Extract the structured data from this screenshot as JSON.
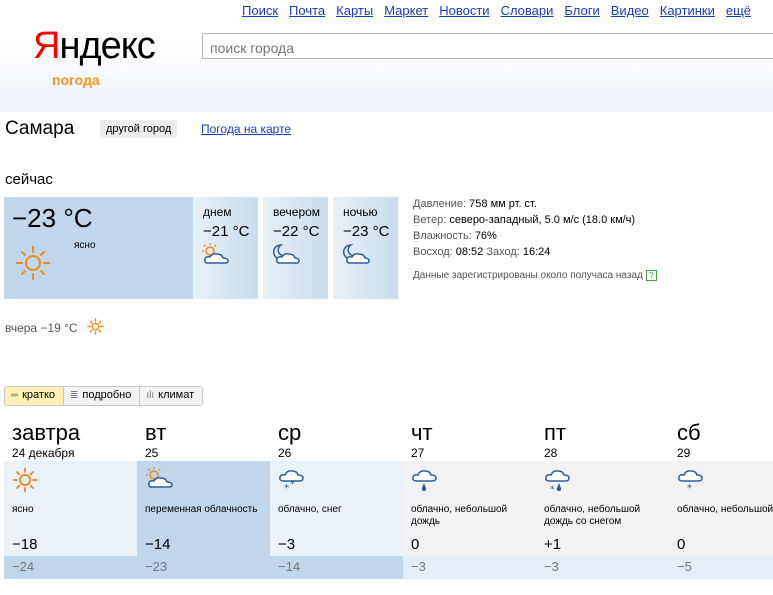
{
  "nav": [
    "Поиск",
    "Почта",
    "Карты",
    "Маркет",
    "Новости",
    "Словари",
    "Блоги",
    "Видео",
    "Картинки",
    "ещё"
  ],
  "logo": {
    "first": "Я",
    "rest": "ндекс",
    "sub": "погода"
  },
  "search": {
    "placeholder": "поиск города"
  },
  "city": {
    "name": "Самара",
    "other_btn": "другой город",
    "map_link": "Погода на карте"
  },
  "now": {
    "label": "сейчас",
    "temp": "−23 °C",
    "condition": "ясно",
    "icon": "sun-icon",
    "parts": [
      {
        "label": "днем",
        "temp": "−21 °C",
        "icon": "sun-cloud-icon"
      },
      {
        "label": "вечером",
        "temp": "−22 °C",
        "icon": "moon-cloud-icon"
      },
      {
        "label": "ночью",
        "temp": "−23 °C",
        "icon": "moon-cloud-icon"
      }
    ]
  },
  "details": {
    "pressure_label": "Давление: ",
    "pressure": "758 мм рт. ст.",
    "wind_label": "Ветер: ",
    "wind": "северо-западный, 5.0 м/с (18.0 км/ч)",
    "humidity_label": "Влажность: ",
    "humidity": "76%",
    "sunrise_label": "Восход: ",
    "sunrise": "08:52",
    "sunset_label": "Заход: ",
    "sunset": "16:24",
    "note": "Данные зарегистрированы около получаса назад",
    "help": "?"
  },
  "yesterday": "вчера −19 °C",
  "tabs": [
    {
      "label": "кратко",
      "glyph": "═"
    },
    {
      "label": "подробно",
      "glyph": "≣"
    },
    {
      "label": "климат",
      "glyph": "ılı"
    }
  ],
  "forecast": [
    {
      "day": "завтра",
      "date": "24 декабря",
      "icon": "sun-icon",
      "condition": "ясно",
      "hi": "−18",
      "lo": "−24"
    },
    {
      "day": "вт",
      "date": "25",
      "icon": "sun-cloud-icon",
      "condition": "переменная облачность",
      "hi": "−14",
      "lo": "−23"
    },
    {
      "day": "ср",
      "date": "26",
      "icon": "cloud-snow-icon",
      "condition": "облачно, снег",
      "hi": "−3",
      "lo": "−14"
    },
    {
      "day": "чт",
      "date": "27",
      "icon": "cloud-rain-icon",
      "condition": "облачно, небольшой дождь",
      "hi": "0",
      "lo": "−3"
    },
    {
      "day": "пт",
      "date": "28",
      "icon": "cloud-rain-snow-icon",
      "condition": "облачно, небольшой дождь со снегом",
      "hi": "+1",
      "lo": "−3"
    },
    {
      "day": "сб",
      "date": "29",
      "icon": "cloud-snow-icon",
      "condition": "облачно, небольшой снег",
      "hi": "0",
      "lo": "−5"
    }
  ]
}
